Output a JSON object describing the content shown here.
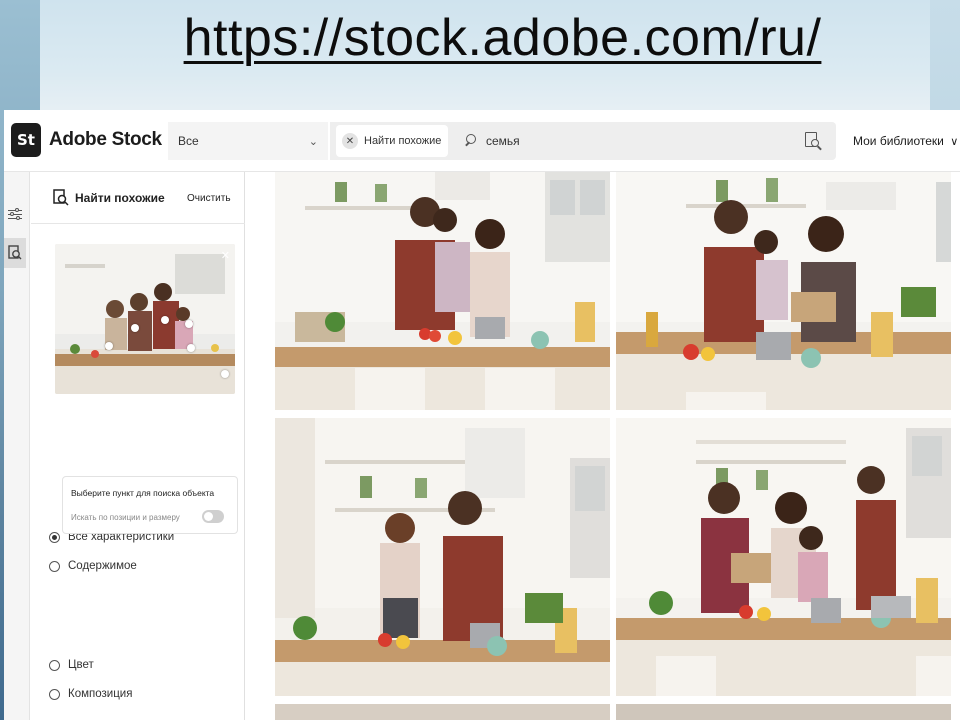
{
  "slide": {
    "url_title": "https://stock.adobe.com/ru/"
  },
  "header": {
    "logo_badge": "St",
    "logo_text": "Adobe Stock",
    "category": "Все",
    "similar_chip": "Найти похожие",
    "search_value": "семья",
    "libraries": "Мои библиотеки"
  },
  "panel": {
    "title": "Найти похожие",
    "clear_label": "Очистить",
    "options": [
      {
        "label": "Все характеристики",
        "checked": true
      },
      {
        "label": "Содержимое",
        "checked": false
      },
      {
        "label": "Цвет",
        "checked": false
      },
      {
        "label": "Композиция",
        "checked": false
      }
    ],
    "sub_option": {
      "title": "Выберите пункт для поиска объекта",
      "toggle_label": "Искать по позиции и размеру"
    }
  },
  "results": [
    {
      "alt": "family-kitchen-photo-1"
    },
    {
      "alt": "family-kitchen-photo-2"
    },
    {
      "alt": "family-kitchen-photo-3"
    },
    {
      "alt": "family-kitchen-photo-4"
    }
  ],
  "colors": {
    "brand_dark": "#1c1c1c",
    "search_bg": "#eeeeee",
    "panel_border": "#e0e0e0"
  }
}
